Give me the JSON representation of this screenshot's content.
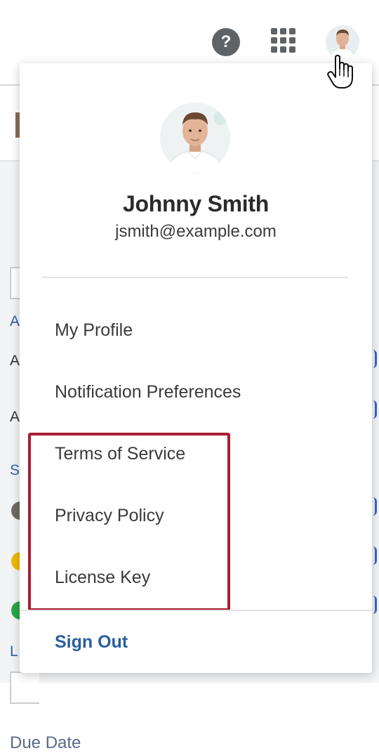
{
  "topbar": {
    "help_icon_glyph": "?",
    "icons": [
      "help-icon",
      "apps-grid-icon",
      "user-avatar",
      "hand-pointer-cursor-icon"
    ]
  },
  "background_page": {
    "side_letters": [
      "A",
      "A",
      "A",
      "S",
      "L"
    ],
    "partial_label": "Due Date",
    "status_dot_colors": [
      "#6f6a64",
      "#f0b800",
      "#27a844"
    ]
  },
  "profile": {
    "name": "Johnny Smith",
    "email": "jsmith@example.com"
  },
  "menu": {
    "items": [
      {
        "label": "My Profile"
      },
      {
        "label": "Notification Preferences"
      },
      {
        "label": "Terms of Service"
      },
      {
        "label": "Privacy Policy"
      },
      {
        "label": "License Key"
      }
    ],
    "sign_out_label": "Sign Out"
  },
  "colors": {
    "accent_link": "#2a5f9e",
    "highlight_border": "#a91e34",
    "icon_gray": "#5f6368"
  }
}
